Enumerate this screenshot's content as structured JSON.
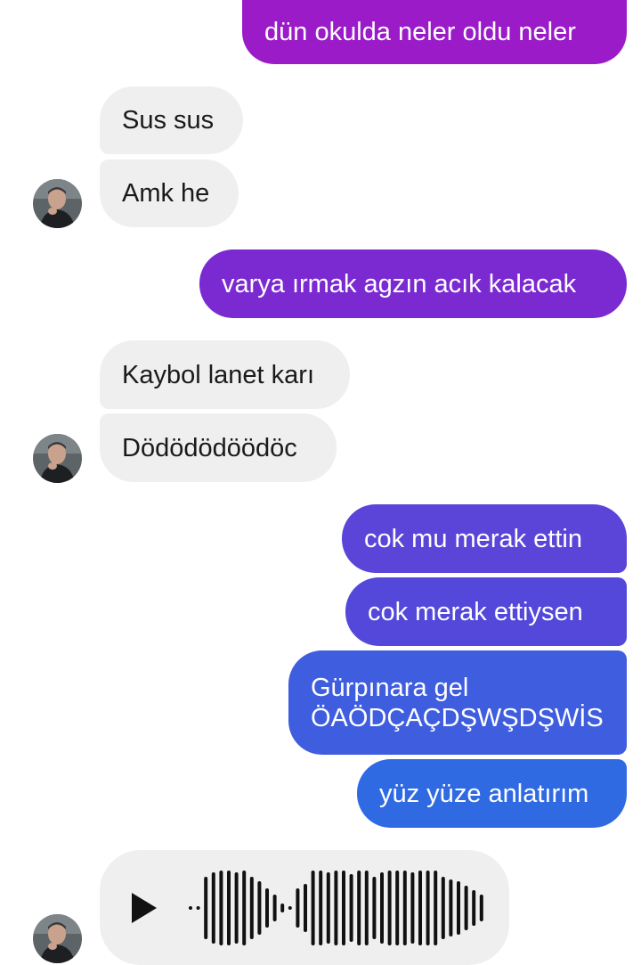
{
  "messages": [
    {
      "id": 1,
      "sender": "me",
      "text": "dün okulda neler oldu neler",
      "color": "#9a1bc7"
    },
    {
      "id": 2,
      "sender": "contact",
      "text": "Sus sus"
    },
    {
      "id": 3,
      "sender": "contact",
      "text": "Amk he"
    },
    {
      "id": 4,
      "sender": "me",
      "text": "varya ırmak agzın acık kalacak",
      "color": "#7b2ad1"
    },
    {
      "id": 5,
      "sender": "contact",
      "text": "Kaybol lanet karı"
    },
    {
      "id": 6,
      "sender": "contact",
      "text": "Dödödödöödöc"
    },
    {
      "id": 7,
      "sender": "me",
      "text": "cok mu merak ettin",
      "color": "#5a45d8"
    },
    {
      "id": 8,
      "sender": "me",
      "text": "cok merak ettiysen",
      "color": "#5348da"
    },
    {
      "id": 9,
      "sender": "me",
      "lines": [
        "Gürpınara gel",
        "ÖAÖDÇAÇDŞWŞDŞWİS"
      ],
      "color": "#3f5ddf"
    },
    {
      "id": 10,
      "sender": "me",
      "text": "yüz yüze anlatırım",
      "color": "#2f6ae3"
    },
    {
      "id": 11,
      "sender": "contact",
      "type": "voice",
      "icon": "play-icon"
    }
  ],
  "colors": {
    "incoming_bubble": "#efefef",
    "incoming_text": "#1a1a1a",
    "outgoing_text": "#ffffff"
  }
}
